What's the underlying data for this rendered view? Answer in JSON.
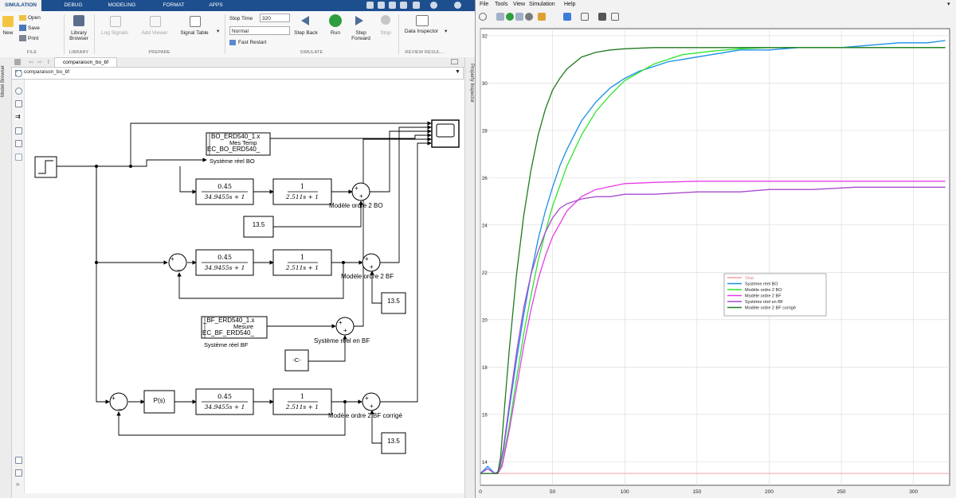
{
  "simulink": {
    "tabs": [
      "SIMULATION",
      "DEBUG",
      "MODELING",
      "FORMAT",
      "APPS"
    ],
    "ribbon": {
      "new_label": "New",
      "open_label": "Open",
      "save_label": "Save",
      "print_label": "Print",
      "library_browser_label": "Library Browser",
      "log_signals_label": "Log Signals",
      "add_viewer_label": "Add Viewer",
      "signal_table_label": "Signal Table",
      "stop_time_label": "Stop Time",
      "stop_time_value": "320",
      "sim_mode": "Normal",
      "fast_restart_label": "Fast Restart",
      "step_back_label": "Step Back",
      "run_label": "Run",
      "step_forward_label": "Step Forward",
      "stop_label": "Stop",
      "data_inspector_label": "Data Inspector",
      "sections": [
        "FILE",
        "LIBRARY",
        "PREPARE",
        "SIMULATE",
        "REVIEW RESUL..."
      ]
    },
    "breadcrumb_tab": "comparaison_bo_bf",
    "address": "comparaison_bo_bf",
    "left_strip_label": "Model Browser",
    "right_strip_label": "Property Inspector",
    "diagram": {
      "tf1_num": "0.45",
      "tf1_den": "34.9455s + 1",
      "tf2_num": "1",
      "tf2_den": "2.511s + 1",
      "bo_file_line1": "BO_ERD540_1.x",
      "bo_file_line2": "Mes Temp",
      "bo_file_line3": "EC_BO_ERD540_",
      "bo_caption": "Système réel BO",
      "bf_file_line1": "_BF_ERD540_1.x",
      "bf_file_line2": "Mesure",
      "bf_file_line3": "EC_BF_ERD540_",
      "bf_caption": "Système réel BF",
      "const_bo": "13.5",
      "const_bf": "13.5",
      "const_bfc": "13.5",
      "const_c": "-C-",
      "pid": "P(s)",
      "caption_bo": "Modèle ordre 2 BO",
      "caption_bf": "Modèle ordre 2 BF",
      "caption_sysbf": "Système réel en BF",
      "caption_bfc": "Modèle ordre 2 BF corrigé"
    }
  },
  "figure": {
    "menu": [
      "File",
      "Tools",
      "View",
      "Simulation",
      "Help"
    ]
  },
  "chart_data": {
    "type": "line",
    "xlim": [
      0,
      325
    ],
    "ylim": [
      13,
      32.3
    ],
    "x_ticks": [
      0,
      50,
      100,
      150,
      200,
      250,
      300
    ],
    "y_ticks": [
      14,
      16,
      18,
      20,
      22,
      24,
      26,
      28,
      30,
      32
    ],
    "grid": true,
    "legend_position": "center-right",
    "series": [
      {
        "name": "Step",
        "color": "#f4a0a0",
        "x": [
          0,
          10,
          10,
          325
        ],
        "y": [
          13.5,
          13.5,
          13.5,
          13.5
        ]
      },
      {
        "name": "Système réel BO",
        "color": "#1a8fe8",
        "x": [
          0,
          5,
          10,
          13,
          16,
          20,
          25,
          30,
          35,
          40,
          45,
          50,
          55,
          60,
          65,
          70,
          75,
          80,
          90,
          100,
          110,
          120,
          130,
          140,
          150,
          160,
          170,
          180,
          200,
          220,
          250,
          270,
          290,
          300,
          310,
          322
        ],
        "y": [
          13.5,
          13.8,
          13.5,
          13.6,
          14.5,
          16.2,
          18.3,
          20.2,
          21.9,
          23.4,
          24.6,
          25.6,
          26.5,
          27.2,
          27.8,
          28.4,
          28.8,
          29.2,
          29.8,
          30.2,
          30.5,
          30.7,
          30.9,
          31.0,
          31.1,
          31.2,
          31.3,
          31.4,
          31.4,
          31.5,
          31.5,
          31.6,
          31.7,
          31.7,
          31.7,
          31.8
        ]
      },
      {
        "name": "Modèle ordre 2 BO",
        "color": "#2ee62e",
        "x": [
          0,
          10,
          12,
          15,
          20,
          25,
          30,
          35,
          40,
          45,
          50,
          60,
          70,
          80,
          90,
          100,
          120,
          140,
          160,
          180,
          200,
          240,
          280,
          322
        ],
        "y": [
          13.5,
          13.5,
          13.5,
          13.9,
          15.5,
          17.5,
          19.4,
          21.0,
          22.5,
          23.7,
          24.8,
          26.5,
          27.8,
          28.8,
          29.5,
          30.1,
          30.8,
          31.2,
          31.35,
          31.45,
          31.5,
          31.5,
          31.5,
          31.5
        ]
      },
      {
        "name": "Modèle ordre 2 BF",
        "color": "#e63ee6",
        "x": [
          0,
          10,
          12,
          15,
          20,
          25,
          30,
          35,
          40,
          45,
          50,
          60,
          70,
          80,
          100,
          120,
          150,
          200,
          250,
          322
        ],
        "y": [
          13.5,
          13.5,
          13.5,
          13.8,
          15.3,
          17.1,
          18.9,
          20.4,
          21.7,
          22.7,
          23.5,
          24.6,
          25.2,
          25.5,
          25.75,
          25.8,
          25.85,
          25.85,
          25.85,
          25.85
        ]
      },
      {
        "name": "Système réel en BF",
        "color": "#a84ad0",
        "x": [
          0,
          5,
          10,
          13,
          16,
          20,
          25,
          30,
          35,
          40,
          45,
          50,
          55,
          60,
          65,
          70,
          80,
          90,
          100,
          120,
          150,
          180,
          200,
          230,
          260,
          290,
          310,
          322
        ],
        "y": [
          13.5,
          13.7,
          13.5,
          13.6,
          14.6,
          16.4,
          18.6,
          20.5,
          21.9,
          22.9,
          23.7,
          24.3,
          24.7,
          24.9,
          25.0,
          25.1,
          25.2,
          25.2,
          25.3,
          25.3,
          25.4,
          25.4,
          25.5,
          25.5,
          25.6,
          25.6,
          25.6,
          25.6
        ]
      },
      {
        "name": "Modèle ordre 2 BF corrigé",
        "color": "#1f7a1f",
        "x": [
          0,
          10,
          12,
          14,
          17,
          20,
          25,
          30,
          35,
          40,
          45,
          50,
          55,
          60,
          70,
          80,
          90,
          100,
          120,
          140,
          160,
          200,
          322
        ],
        "y": [
          13.5,
          13.5,
          13.5,
          14.2,
          16.5,
          18.7,
          21.9,
          24.4,
          26.3,
          27.8,
          28.9,
          29.7,
          30.2,
          30.6,
          31.1,
          31.3,
          31.4,
          31.45,
          31.5,
          31.5,
          31.5,
          31.5,
          31.5
        ]
      }
    ]
  }
}
